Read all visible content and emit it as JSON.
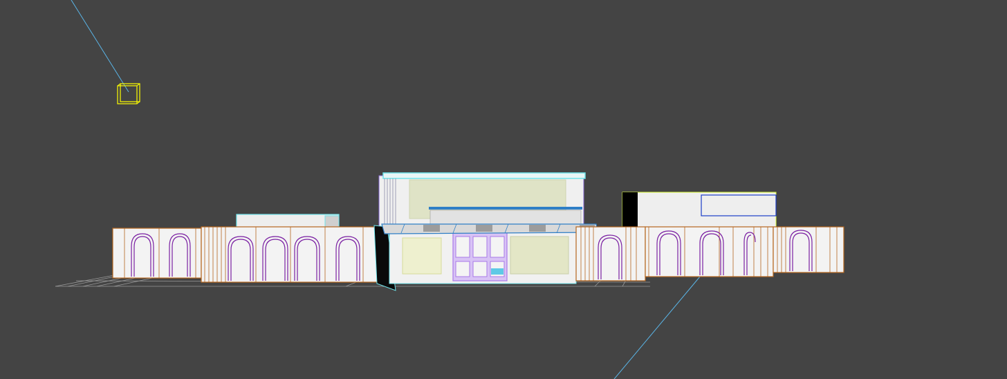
{
  "viewport": {
    "background": "#444444",
    "kind": "3d-perspective-viewport"
  },
  "colors": {
    "facade_fill": "#f3f3f3",
    "wall_outline": "#b5651d",
    "arch_outline": "#7a1fa2",
    "glass_fill": "#dfe6c8",
    "window_frame": "#c9a8f0",
    "cyan_edge": "#6fe3ea",
    "blue_beam": "#2f7fc6",
    "selection_box": "#ffff00",
    "camera_line": "#5ab4e6",
    "dark_panel": "#000000",
    "grid": "#9a9a9a"
  },
  "objects": {
    "camera_helper_icon": "camera-target-box",
    "ground_grid_icon": "ground-grid"
  }
}
